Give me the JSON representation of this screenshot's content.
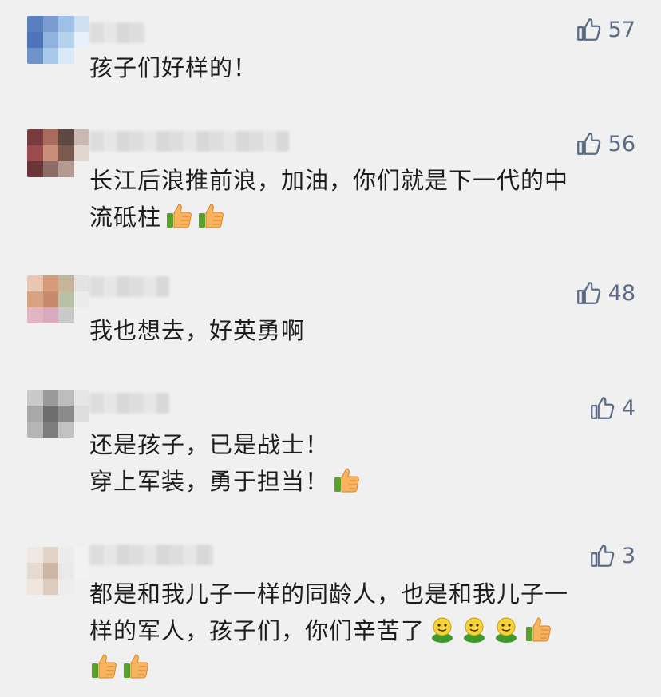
{
  "comments": [
    {
      "likes": "57",
      "lines": [
        "孩子们好样的！"
      ]
    },
    {
      "likes": "56",
      "lines": [
        "长江后浪推前浪，加油，你们就是下一代的中",
        "流砥柱"
      ]
    },
    {
      "likes": "48",
      "lines": [
        "我也想去，好英勇啊"
      ]
    },
    {
      "likes": "4",
      "lines": [
        "还是孩子，已是战士！",
        "穿上军装，勇于担当！"
      ]
    },
    {
      "likes": "3",
      "lines": [
        "都是和我儿子一样的同龄人，也是和我儿子一",
        "样的军人，孩子们，你们辛苦了"
      ]
    }
  ],
  "icons": {
    "like": "thumbs-up-outline-icon",
    "emoji_thumb": "thumbs-up-emoji-icon",
    "emoji_face": "smiley-emoji-icon"
  },
  "colors": {
    "background": "#f0f0f0",
    "like_text": "#5b6c86",
    "text": "#1d1d1d"
  }
}
